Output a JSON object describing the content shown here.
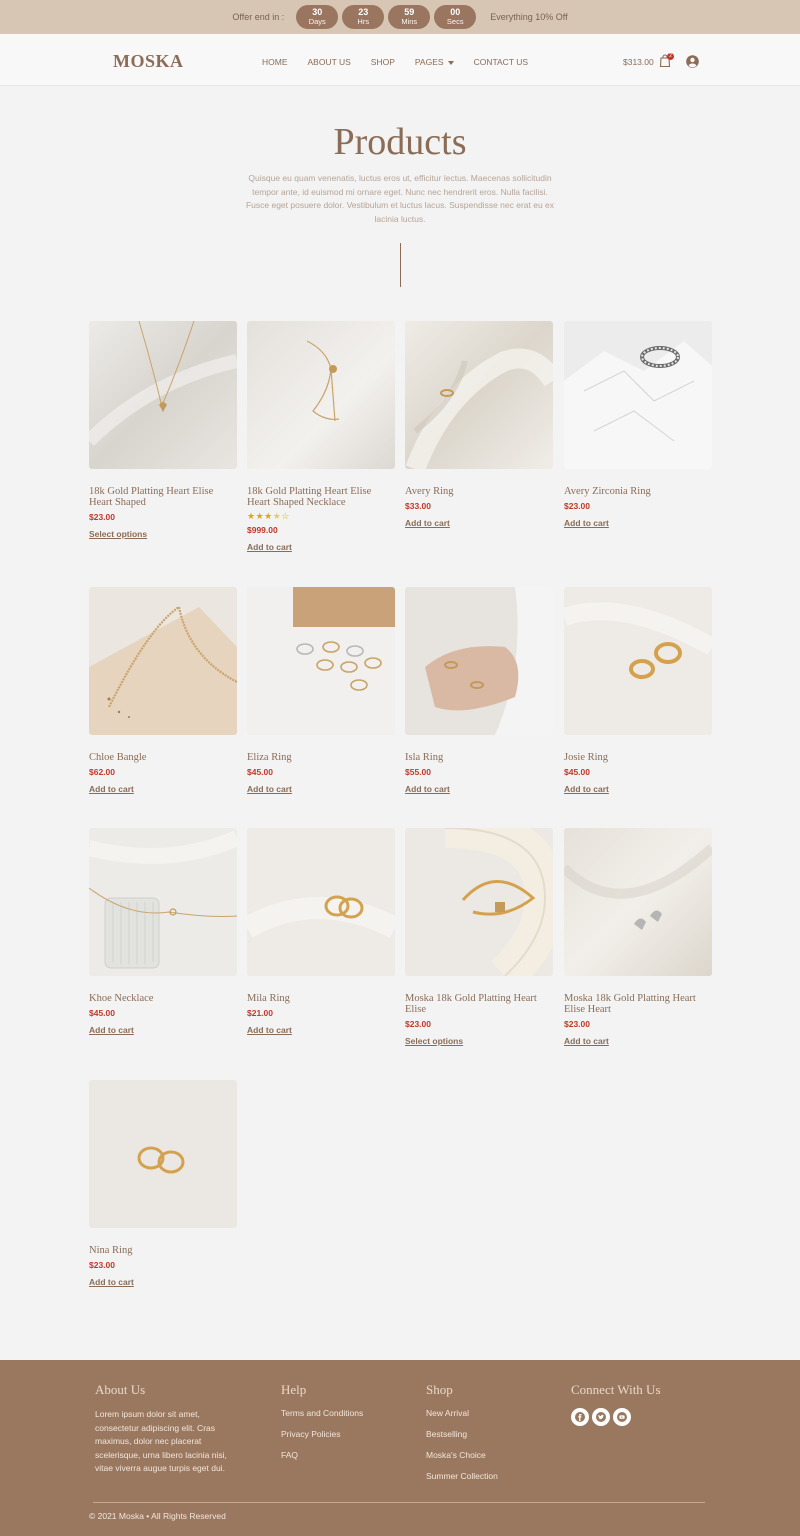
{
  "offer": {
    "label": "Offer end in :",
    "countdown": [
      {
        "num": "30",
        "unit": "Days"
      },
      {
        "num": "23",
        "unit": "Hrs"
      },
      {
        "num": "59",
        "unit": "Mins"
      },
      {
        "num": "00",
        "unit": "Secs"
      }
    ],
    "right_text": "Everything 10% Off"
  },
  "header": {
    "logo": "MOSKA",
    "nav": [
      "HOME",
      "ABOUT US",
      "SHOP",
      "PAGES",
      "CONTACT US"
    ],
    "cart_amount": "$313.00",
    "cart_count": "2"
  },
  "hero": {
    "title": "Products",
    "description": "Quisque eu quam venenatis, luctus eros ut, efficitur lectus. Maecenas sollicitudin tempor ante, id euismod mi ornare eget. Nunc nec hendrerit eros. Nulla facilisi. Fusce eget posuere dolor. Vestibulum et luctus lacus. Suspendisse nec erat eu ex lacinia luctus."
  },
  "products": [
    {
      "name": "18k Gold Platting Heart Elise Heart Shaped",
      "price": "$23.00",
      "action": "Select options",
      "rating": 0,
      "image": "heart-necklace"
    },
    {
      "name": "18k Gold Platting Heart Elise Heart Shaped Necklace",
      "price": "$999.00",
      "action": "Add to cart",
      "rating": 3.5,
      "image": "chain-necklace"
    },
    {
      "name": "Avery Ring",
      "price": "$33.00",
      "action": "Add to cart",
      "rating": 0,
      "image": "satin-ring"
    },
    {
      "name": "Avery Zirconia Ring",
      "price": "$23.00",
      "action": "Add to cart",
      "rating": 0,
      "image": "zirconia-ring"
    },
    {
      "name": "Chloe Bangle",
      "price": "$62.00",
      "action": "Add to cart",
      "rating": 0,
      "image": "bangle"
    },
    {
      "name": "Eliza Ring",
      "price": "$45.00",
      "action": "Add to cart",
      "rating": 0,
      "image": "ring-set"
    },
    {
      "name": "Isla Ring",
      "price": "$55.00",
      "action": "Add to cart",
      "rating": 0,
      "image": "hand-rings"
    },
    {
      "name": "Josie Ring",
      "price": "$45.00",
      "action": "Add to cart",
      "rating": 0,
      "image": "gold-rings"
    },
    {
      "name": "Khoe Necklace",
      "price": "$45.00",
      "action": "Add to cart",
      "rating": 0,
      "image": "glass-necklace"
    },
    {
      "name": "Mila Ring",
      "price": "$21.00",
      "action": "Add to cart",
      "rating": 0,
      "image": "mila-rings"
    },
    {
      "name": "Moska 18k Gold Platting Heart Elise",
      "price": "$23.00",
      "action": "Select options",
      "rating": 0,
      "image": "cuff"
    },
    {
      "name": "Moska 18k Gold Platting Heart Elise Heart",
      "price": "$23.00",
      "action": "Add to cart",
      "rating": 0,
      "image": "earrings"
    },
    {
      "name": "Nina Ring",
      "price": "$23.00",
      "action": "Add to cart",
      "rating": 0,
      "image": "nina-rings"
    }
  ],
  "footer": {
    "about": {
      "title": "About Us",
      "text": "Lorem ipsum dolor sit amet, consectetur adipiscing elit. Cras maximus, dolor nec placerat scelerisque, urna libero lacinia nisi, vitae viverra augue turpis eget dui."
    },
    "help": {
      "title": "Help",
      "links": [
        "Terms and Conditions",
        "Privacy Policies",
        "FAQ"
      ]
    },
    "shop": {
      "title": "Shop",
      "links": [
        "New Arrival",
        "Bestselling",
        "Moska's Choice",
        "Summer Collection"
      ]
    },
    "connect": {
      "title": "Connect With Us",
      "icons": [
        "facebook-icon",
        "twitter-icon",
        "youtube-icon"
      ]
    },
    "copyright": "© 2021 Moska • All Rights Reserved"
  },
  "colors": {
    "accent": "#8a6c57",
    "price": "#c0392b",
    "footer_bg": "#9a7860",
    "offer_bg": "#d7c6b3"
  }
}
